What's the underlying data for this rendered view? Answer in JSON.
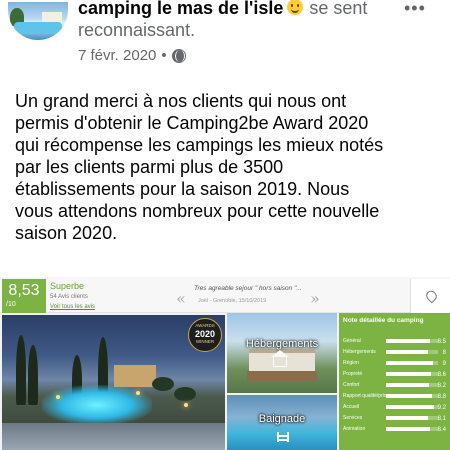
{
  "post": {
    "author": "camping le mas de l'isle",
    "feeling": "se sent",
    "feeling_line2": "reconnaissant.",
    "date": "7 févr. 2020",
    "separator": "•",
    "more": "•••",
    "text_lines": [
      "Un grand merci à nos clients qui nous ont",
      "permis d'obtenir le Camping2be Award 2020",
      "qui récompense les campings les mieux notés",
      "par les clients parmi plus de 3500",
      "établissements pour la saison 2019. Nous",
      "vous attendons nombreux pour cette nouvelle",
      "saison 2020."
    ]
  },
  "image": {
    "score": "8,53",
    "score_scale": "/10",
    "score_label": "Superbe",
    "review_count": "54 Avis clients",
    "see_reviews": "Voir tous les avis",
    "quote_open": "«",
    "quote_close": "»",
    "review_quote": "Tres agreable sejour \" hors saison \"...",
    "review_author": "Joël - Grenoble, 15/10/2019",
    "award": {
      "line1": "AWARDS",
      "year": "2020",
      "line3": "WINNER"
    },
    "tiles": {
      "accommodation": "Hébergements",
      "swimming": "Baignade"
    },
    "rating_title": "Note détaillée du camping",
    "ratings": [
      {
        "label": "Général",
        "value": "8.5",
        "fraction": 0.85
      },
      {
        "label": "Hébergements",
        "value": "8",
        "fraction": 0.8
      },
      {
        "label": "Région",
        "value": "9",
        "fraction": 0.9
      },
      {
        "label": "Propreté",
        "value": "8.6",
        "fraction": 0.86
      },
      {
        "label": "Confort",
        "value": "8.2",
        "fraction": 0.82
      },
      {
        "label": "Rapport qualité/prix",
        "value": "8.8",
        "fraction": 0.88
      },
      {
        "label": "Accueil",
        "value": "9.2",
        "fraction": 0.92
      },
      {
        "label": "Services",
        "value": "8.1",
        "fraction": 0.81
      },
      {
        "label": "Animation",
        "value": "8.4",
        "fraction": 0.84
      }
    ]
  },
  "colors": {
    "rating_green": "#7cb342",
    "meta_grey": "#65676b"
  }
}
